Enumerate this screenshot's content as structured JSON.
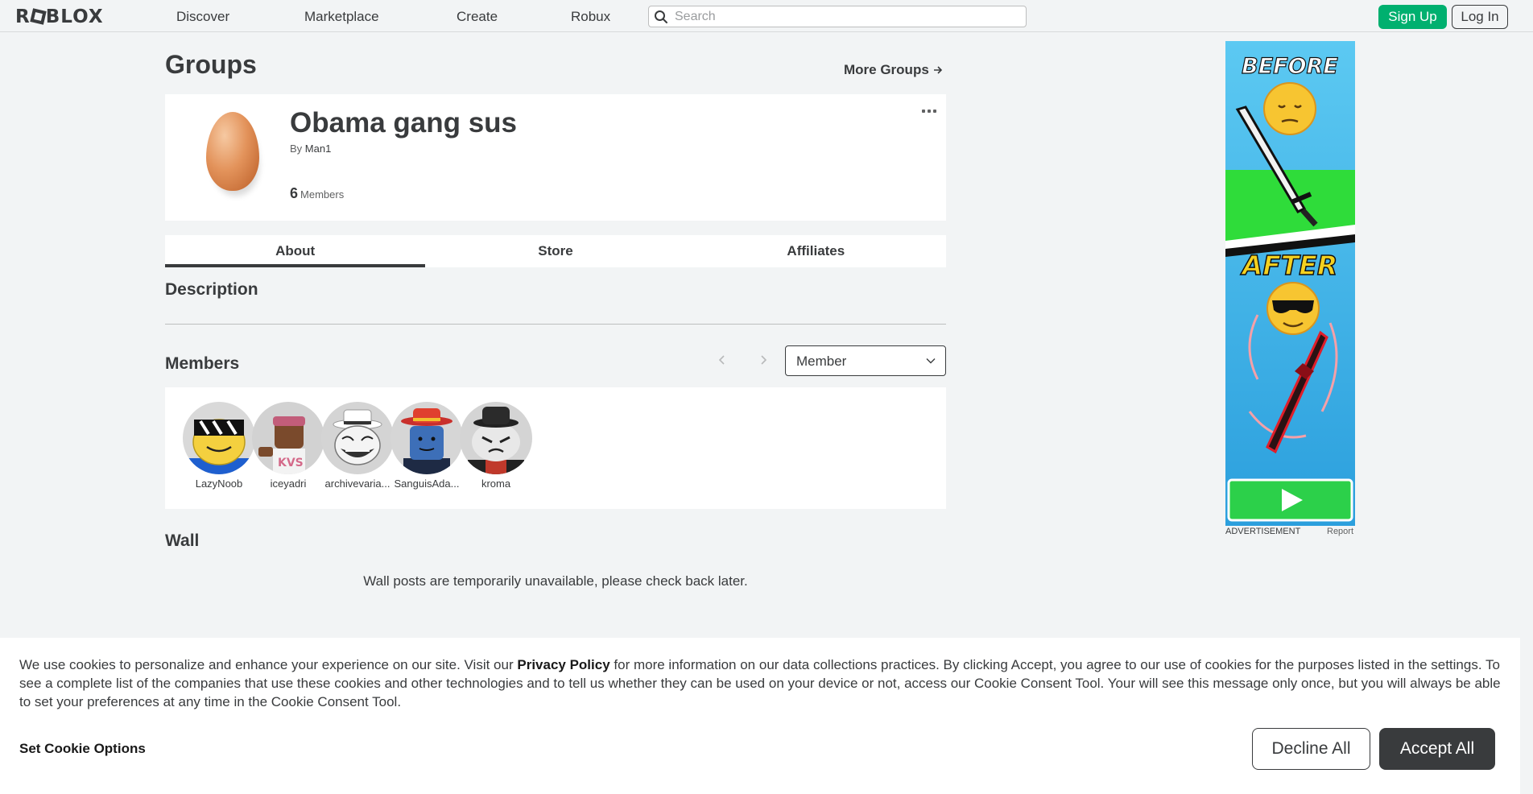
{
  "header": {
    "logo_text": "ROBLOX",
    "nav": [
      {
        "label": "Discover"
      },
      {
        "label": "Marketplace"
      },
      {
        "label": "Create"
      },
      {
        "label": "Robux"
      }
    ],
    "search_placeholder": "Search",
    "signup_label": "Sign Up",
    "login_label": "Log In"
  },
  "page": {
    "title": "Groups",
    "more_groups_label": "More Groups"
  },
  "group": {
    "name": "Obama gang sus",
    "by_label": "By",
    "owner": "Man1",
    "member_count": "6",
    "members_label": "Members"
  },
  "tabs": [
    {
      "label": "About",
      "active": true
    },
    {
      "label": "Store",
      "active": false
    },
    {
      "label": "Affiliates",
      "active": false
    }
  ],
  "sections": {
    "description_title": "Description",
    "members_title": "Members",
    "wall_title": "Wall",
    "wall_message": "Wall posts are temporarily unavailable, please check back later."
  },
  "role_filter": {
    "selected": "Member"
  },
  "members": [
    {
      "name": "LazyNoob"
    },
    {
      "name": "iceyadri"
    },
    {
      "name": "archivevaria..."
    },
    {
      "name": "SanguisAda..."
    },
    {
      "name": "kroma"
    }
  ],
  "ad": {
    "before_text": "BEFORE",
    "after_text": "AFTER",
    "label": "ADVERTISEMENT",
    "report_label": "Report"
  },
  "cookie": {
    "text_before": "We use cookies to personalize and enhance your experience on our site. Visit our ",
    "privacy_link": "Privacy Policy",
    "text_after": " for more information on our data collections practices. By clicking Accept, you agree to our use of cookies for the purposes listed in the settings. To see a complete list of the companies that use these cookies and other technologies and to tell us whether they can be used on your device or not, access our Cookie Consent Tool. Your will see this message only once, but you will always be able to set your preferences at any time in the Cookie Consent Tool.",
    "set_options_label": "Set Cookie Options",
    "decline_label": "Decline All",
    "accept_label": "Accept All"
  },
  "colors": {
    "brand_green": "#00b06f",
    "text_primary": "#393b3d",
    "background": "#f2f4f5"
  }
}
